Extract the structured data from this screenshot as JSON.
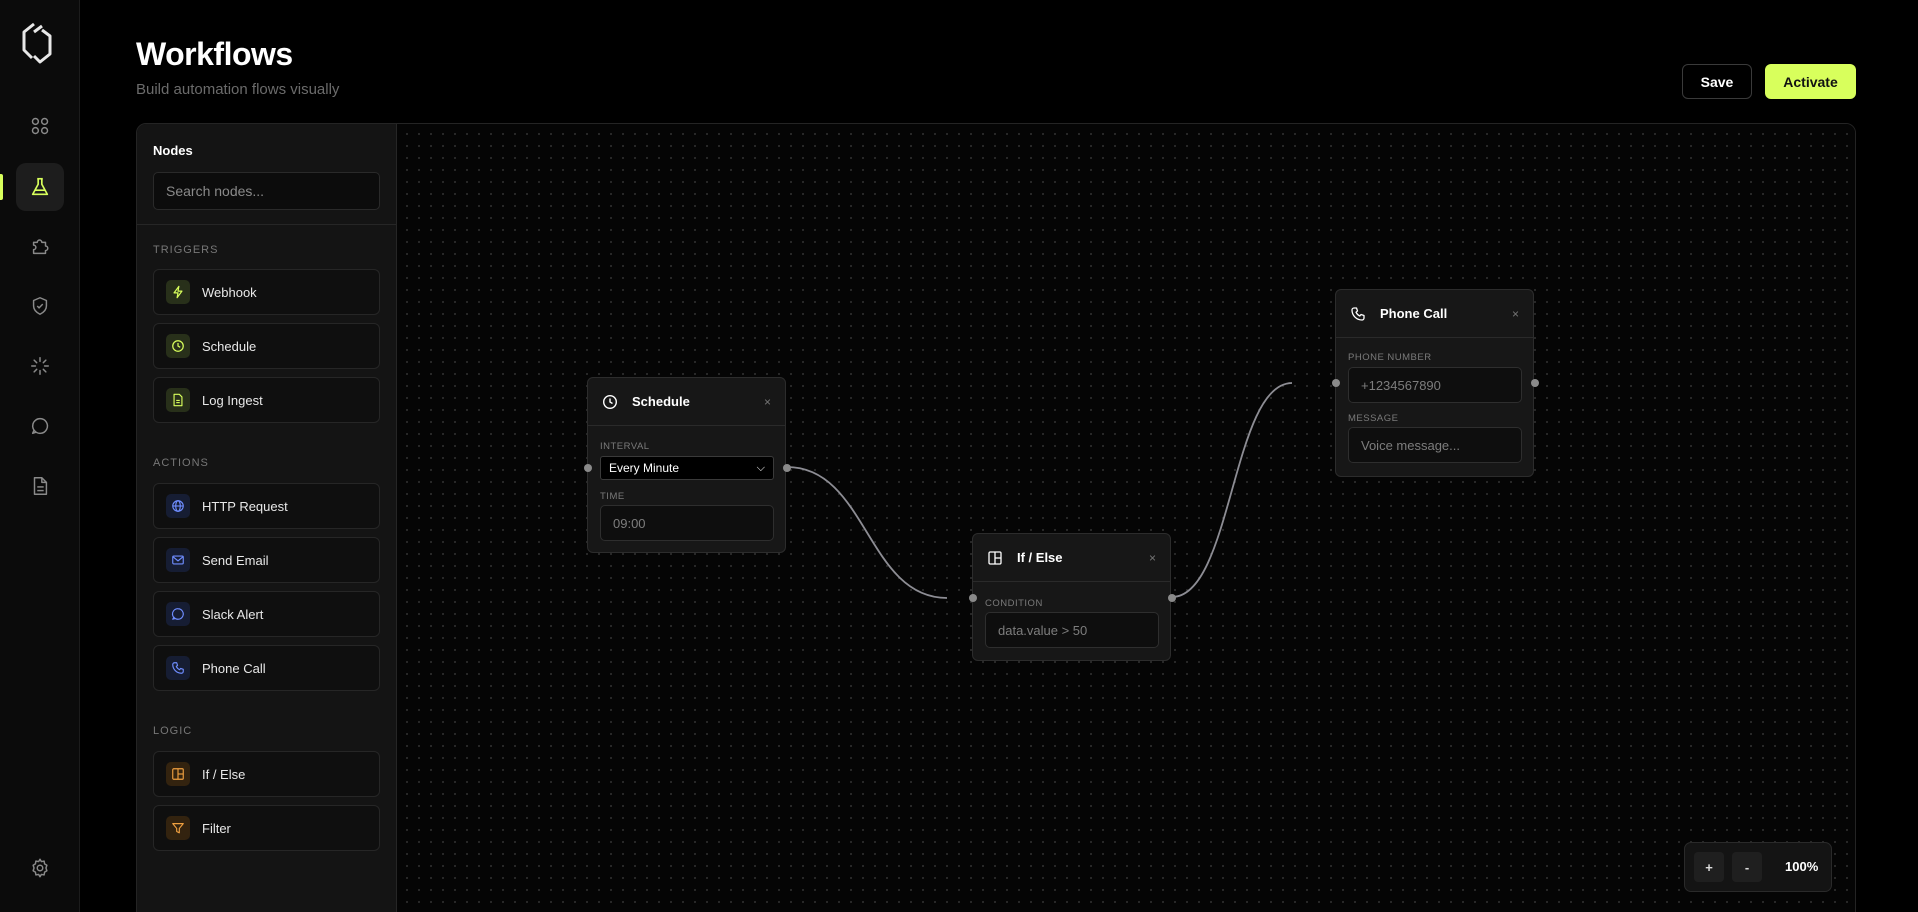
{
  "header": {
    "title": "Workflows",
    "subtitle": "Build automation flows visually",
    "save_label": "Save",
    "activate_label": "Activate"
  },
  "colors": {
    "accent": "#d8ff5c",
    "background": "#000000",
    "panel": "#141414"
  },
  "rail": {
    "items": [
      {
        "icon": "logo-icon"
      },
      {
        "icon": "grid-icon"
      },
      {
        "icon": "flask-icon",
        "active": true
      },
      {
        "icon": "puzzle-icon"
      },
      {
        "icon": "shield-check-icon"
      },
      {
        "icon": "loader-icon"
      },
      {
        "icon": "message-icon"
      },
      {
        "icon": "document-icon"
      },
      {
        "icon": "settings-icon"
      }
    ]
  },
  "sidebar": {
    "title": "Nodes",
    "search_placeholder": "Search nodes...",
    "sections": {
      "triggers": {
        "label": "TRIGGERS",
        "items": [
          {
            "label": "Webhook",
            "icon": "bolt-icon"
          },
          {
            "label": "Schedule",
            "icon": "clock-icon"
          },
          {
            "label": "Log Ingest",
            "icon": "file-icon"
          }
        ]
      },
      "actions": {
        "label": "ACTIONS",
        "items": [
          {
            "label": "HTTP Request",
            "icon": "globe-icon"
          },
          {
            "label": "Send Email",
            "icon": "mail-icon"
          },
          {
            "label": "Slack Alert",
            "icon": "chat-icon"
          },
          {
            "label": "Phone Call",
            "icon": "phone-icon"
          }
        ]
      },
      "logic": {
        "label": "LOGIC",
        "items": [
          {
            "label": "If / Else",
            "icon": "branch-icon"
          },
          {
            "label": "Filter",
            "icon": "filter-icon"
          }
        ]
      }
    }
  },
  "canvas": {
    "nodes": {
      "schedule": {
        "title": "Schedule",
        "close": "×",
        "interval_label": "INTERVAL",
        "interval_value": "Every Minute",
        "time_label": "TIME",
        "time_placeholder": "09:00"
      },
      "ifelse": {
        "title": "If / Else",
        "close": "×",
        "condition_label": "CONDITION",
        "condition_placeholder": "data.value > 50"
      },
      "phone": {
        "title": "Phone Call",
        "close": "×",
        "number_label": "PHONE NUMBER",
        "number_placeholder": "+1234567890",
        "message_label": "MESSAGE",
        "message_placeholder": "Voice message..."
      }
    },
    "zoom": {
      "plus": "+",
      "minus": "-",
      "level": "100%"
    }
  }
}
